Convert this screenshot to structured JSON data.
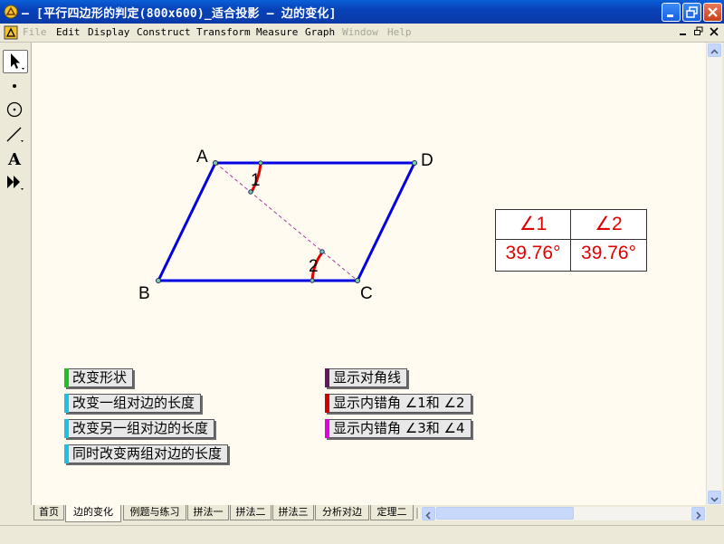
{
  "window": {
    "title": "– [平行四边形的判定(800x600)_适合投影 – 边的变化]",
    "title_color": "#ffffff"
  },
  "menu": {
    "items": [
      {
        "label": "File",
        "disabled": true
      },
      {
        "label": "Edit",
        "disabled": false
      },
      {
        "label": "Display",
        "disabled": false
      },
      {
        "label": "Construct",
        "disabled": false
      },
      {
        "label": "Transform",
        "disabled": false
      },
      {
        "label": "Measure",
        "disabled": false
      },
      {
        "label": "Graph",
        "disabled": false
      },
      {
        "label": "Window",
        "disabled": true
      },
      {
        "label": "Help",
        "disabled": true
      }
    ]
  },
  "toolbox": {
    "tools": [
      "arrow-select-icon",
      "point-tool-icon",
      "compass-tool-icon",
      "straightedge-tool-icon",
      "text-tool-icon",
      "custom-tool-icon"
    ],
    "selected": "arrow-select-icon"
  },
  "figure": {
    "points": {
      "A": "A",
      "B": "B",
      "C": "C",
      "D": "D"
    },
    "angle_labels": {
      "angle1": "1",
      "angle2": "2"
    },
    "shape_color": "#0000e0",
    "diagonal_color": "#a040a0",
    "angle_color": "#e00000"
  },
  "angle_table": {
    "headers": [
      "∠1",
      "∠2"
    ],
    "values": [
      "39.76°",
      "39.76°"
    ],
    "text_color": "#e00000"
  },
  "buttons": {
    "left": [
      {
        "label": "改变形状",
        "color": "#20c020"
      },
      {
        "label": "改变一组对边的长度",
        "color": "#20c0e0"
      },
      {
        "label": "改变另一组对边的长度",
        "color": "#20c0e0"
      },
      {
        "label": "同时改变两组对边的长度",
        "color": "#20c0e0"
      }
    ],
    "right": [
      {
        "label": "显示对角线",
        "color": "#601860"
      },
      {
        "label": "显示内错角 ∠1和 ∠2",
        "color": "#d00000"
      },
      {
        "label": "显示内错角 ∠3和 ∠4",
        "color": "#e000e0"
      }
    ]
  },
  "tabs": {
    "items": [
      "首页",
      "边的变化",
      "例题与练习",
      "拼法一",
      "拼法二",
      "拼法三",
      "分析对边",
      "定理二"
    ],
    "active": "边的变化"
  }
}
